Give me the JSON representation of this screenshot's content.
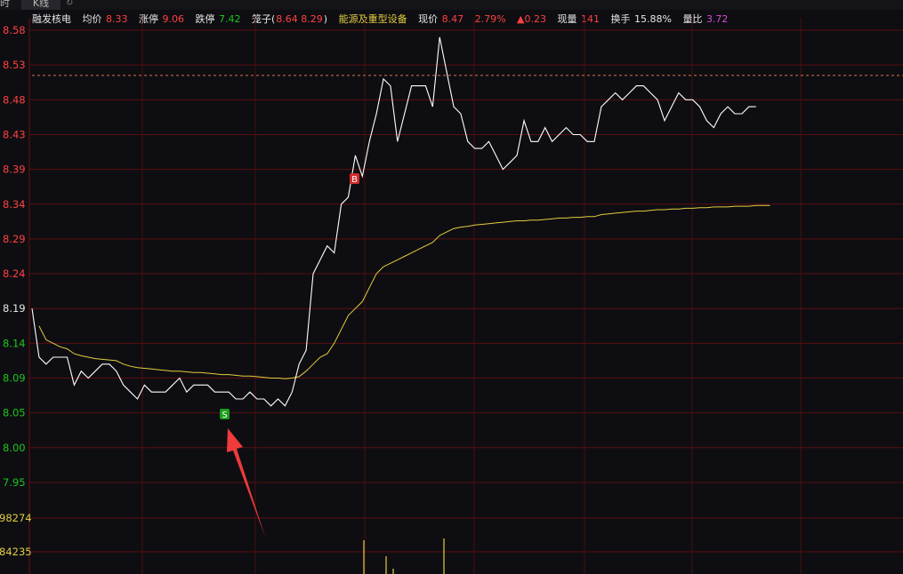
{
  "tabs": {
    "time": "时",
    "kline": "K线",
    "history_icon": "clock-refresh-icon"
  },
  "quote": {
    "name": "融发核电",
    "avg_label": "均价",
    "avg": "8.33",
    "limit_up_label": "涨停",
    "limit_up": "9.06",
    "limit_down_label": "跌停",
    "limit_down": "7.42",
    "cage_label": "笼子(",
    "cage_values": "8.64 8.29",
    "cage_close": ")",
    "sector": "能源及重型设备",
    "price_label": "现价",
    "price": "8.47",
    "pct": "2.79%",
    "change": "▲0.23",
    "vol_label": "现量",
    "vol": "141",
    "turnover_label": "换手",
    "turnover": "15.88%",
    "ratio_label": "量比",
    "ratio": "3.72"
  },
  "colors": {
    "up": "#ff4040",
    "down": "#1ec41e",
    "avg_line": "#e3cd3f",
    "price_line": "#ffffff",
    "grid": "#5a0f0f",
    "background": "#0e0e12"
  },
  "chart_data": {
    "type": "line",
    "y_ticks": [
      "8.58",
      "8.53",
      "8.48",
      "8.43",
      "8.39",
      "8.34",
      "8.29",
      "8.24",
      "8.19",
      "8.14",
      "8.09",
      "8.05",
      "8.00",
      "7.95"
    ],
    "ylim": [
      7.95,
      8.58
    ],
    "reference_line": 8.515,
    "volume_ticks": [
      "98274",
      "84235"
    ],
    "x": [
      0,
      1,
      2,
      3,
      4,
      5,
      6,
      7,
      8,
      9,
      10,
      11,
      12,
      13,
      14,
      15,
      16,
      17,
      18,
      19,
      20,
      21,
      22,
      23,
      24,
      25,
      26,
      27,
      28,
      29,
      30,
      31,
      32,
      33,
      34,
      35,
      36,
      37,
      38,
      39,
      40,
      41,
      42,
      43,
      44,
      45,
      46,
      47,
      48,
      49,
      50,
      51,
      52,
      53,
      54,
      55,
      56,
      57,
      58,
      59,
      60,
      61,
      62,
      63,
      64,
      65,
      66,
      67,
      68,
      69,
      70,
      71,
      72,
      73,
      74,
      75,
      76,
      77,
      78,
      79,
      80,
      81,
      82,
      83,
      84,
      85,
      86,
      87,
      88,
      89,
      90,
      91,
      92,
      93,
      94,
      95,
      96,
      97,
      98,
      99,
      100,
      101,
      102,
      103,
      104,
      105
    ],
    "series": [
      {
        "values": [
          8.18,
          8.11,
          8.1,
          8.11,
          8.11,
          8.11,
          8.07,
          8.09,
          8.08,
          8.09,
          8.1,
          8.1,
          8.09,
          8.07,
          8.06,
          8.05,
          8.07,
          8.06,
          8.06,
          8.06,
          8.07,
          8.08,
          8.06,
          8.07,
          8.07,
          8.07,
          8.06,
          8.06,
          8.06,
          8.05,
          8.05,
          8.06,
          8.05,
          8.05,
          8.04,
          8.05,
          8.04,
          8.06,
          8.1,
          8.12,
          8.23,
          8.25,
          8.27,
          8.26,
          8.33,
          8.34,
          8.4,
          8.37,
          8.42,
          8.46,
          8.51,
          8.5,
          8.42,
          8.46,
          8.5,
          8.5,
          8.5,
          8.47,
          8.57,
          8.52,
          8.47,
          8.46,
          8.42,
          8.41,
          8.41,
          8.42,
          8.4,
          8.38,
          8.39,
          8.4,
          8.45,
          8.42,
          8.42,
          8.44,
          8.42,
          8.43,
          8.44,
          8.43,
          8.43,
          8.42,
          8.42,
          8.47,
          8.48,
          8.49,
          8.48,
          8.49,
          8.5,
          8.5,
          8.49,
          8.48,
          8.45,
          8.47,
          8.49,
          8.48,
          8.48,
          8.47,
          8.45,
          8.44,
          8.46,
          8.47,
          8.46,
          8.46,
          8.47,
          8.47
        ]
      },
      {
        "values": [
          null,
          8.155,
          8.135,
          8.13,
          8.125,
          8.122,
          8.115,
          8.112,
          8.11,
          8.108,
          8.107,
          8.106,
          8.105,
          8.1,
          8.097,
          8.095,
          8.094,
          8.093,
          8.092,
          8.091,
          8.09,
          8.09,
          8.089,
          8.088,
          8.088,
          8.087,
          8.086,
          8.085,
          8.085,
          8.084,
          8.083,
          8.083,
          8.082,
          8.081,
          8.08,
          8.08,
          8.079,
          8.08,
          8.082,
          8.09,
          8.1,
          8.11,
          8.115,
          8.13,
          8.15,
          8.17,
          8.18,
          8.19,
          8.21,
          8.23,
          8.24,
          8.245,
          8.25,
          8.255,
          8.26,
          8.265,
          8.27,
          8.275,
          8.285,
          8.29,
          8.295,
          8.297,
          8.298,
          8.3,
          8.301,
          8.302,
          8.303,
          8.304,
          8.305,
          8.306,
          8.306,
          8.307,
          8.307,
          8.308,
          8.309,
          8.31,
          8.31,
          8.311,
          8.311,
          8.312,
          8.312,
          8.315,
          8.316,
          8.317,
          8.318,
          8.319,
          8.32,
          8.32,
          8.321,
          8.322,
          8.322,
          8.323,
          8.323,
          8.324,
          8.324,
          8.325,
          8.325,
          8.326,
          8.326,
          8.326,
          8.327,
          8.327,
          8.327,
          8.328,
          8.328,
          8.328
        ]
      }
    ],
    "volume": [
      null,
      null,
      null,
      null,
      null,
      null,
      null,
      null,
      null,
      null,
      null,
      null,
      null,
      null,
      null,
      null,
      null,
      null,
      null,
      null,
      null,
      null,
      null,
      null,
      null,
      null,
      null,
      null,
      null,
      null,
      null,
      null,
      null,
      null,
      null,
      null,
      null,
      null,
      null,
      null,
      null,
      null,
      null,
      null,
      null,
      null,
      null,
      null,
      null,
      null,
      null,
      null,
      null,
      null,
      null,
      null,
      null,
      null,
      null,
      null,
      null,
      null,
      null,
      null,
      null,
      null,
      null,
      null,
      null,
      null,
      null,
      null,
      null,
      null,
      null,
      null,
      null,
      null,
      null,
      null,
      null,
      null,
      null,
      null,
      null,
      null,
      null,
      null,
      null,
      null,
      null,
      null,
      null,
      null,
      null,
      null,
      null,
      null,
      null,
      null,
      null,
      null,
      null,
      null,
      null,
      null
    ],
    "markers": [
      {
        "label": "B",
        "kind": "buy"
      },
      {
        "label": "S",
        "kind": "sell"
      }
    ]
  }
}
